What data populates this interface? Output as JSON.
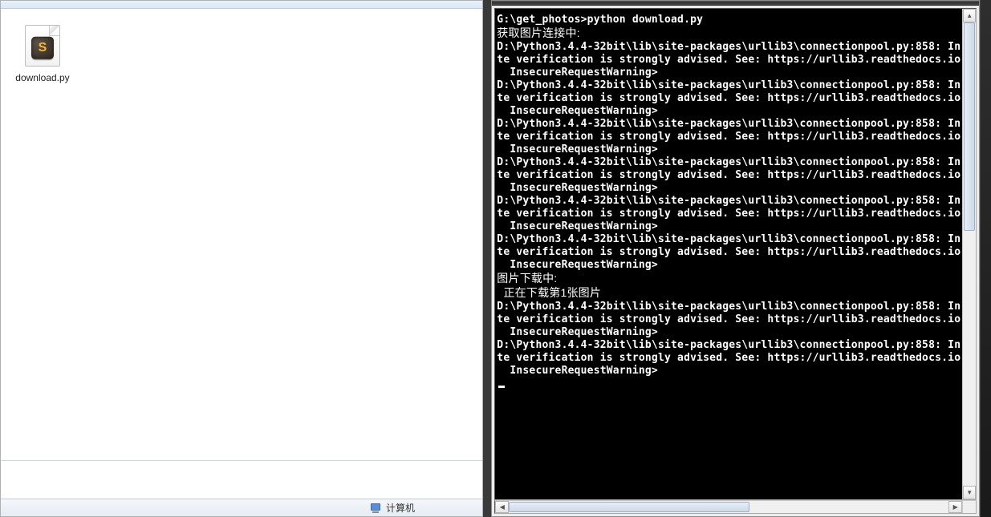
{
  "explorer": {
    "files": [
      {
        "name": "download.py",
        "icon_letter": "S"
      }
    ],
    "status": {
      "label": "计算机"
    }
  },
  "terminal": {
    "prompt_line": "G:\\get_photos>python download.py",
    "status_fetching": "获取图片连接中:",
    "warning_line1": "D:\\Python3.4.4-32bit\\lib\\site-packages\\urllib3\\connectionpool.py:858: In",
    "warning_line2": "te verification is strongly advised. See: https://urllib3.readthedocs.io",
    "warning_line3": "  InsecureRequestWarning>",
    "status_downloading": "图片下载中:",
    "status_current": "  正在下载第1张图片",
    "warning_repeat_count_before": 6,
    "warning_repeat_count_after": 2
  }
}
